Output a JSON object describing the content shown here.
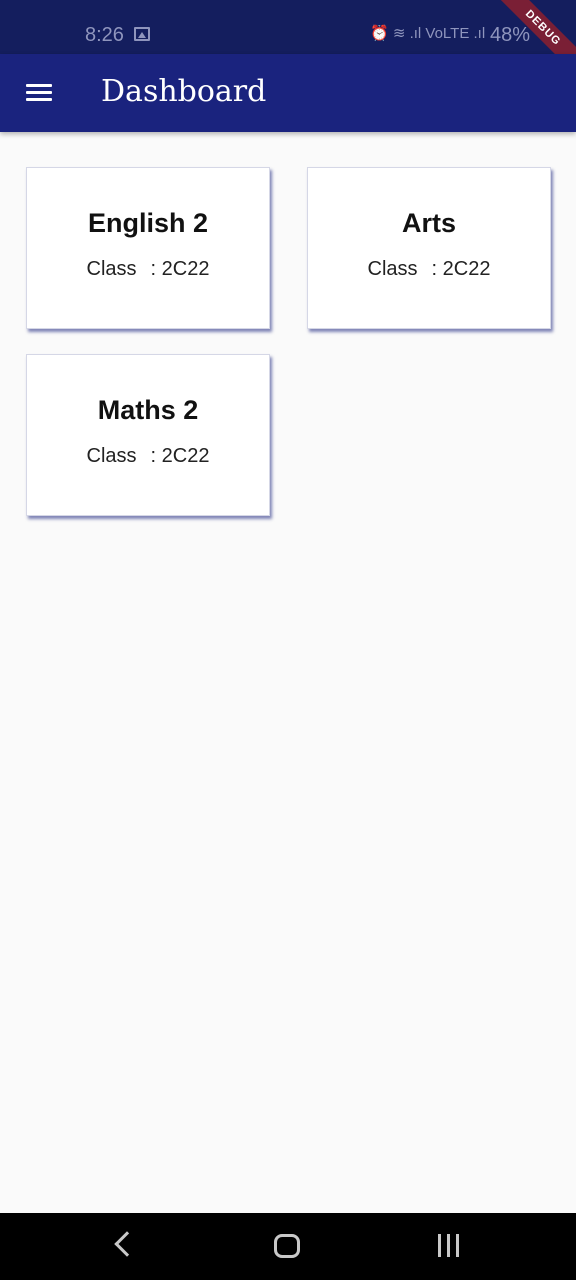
{
  "status_bar": {
    "time": "8:26",
    "network_icons": "⏰ ≋ .ıl VoLTE .ıl",
    "battery": "48%"
  },
  "debug_banner": "DEBUG",
  "app_bar": {
    "title": "Dashboard",
    "menu_icon": "menu-icon"
  },
  "cards": [
    {
      "title": "English 2",
      "class_label": "Class",
      "class_value": ": 2C22"
    },
    {
      "title": "Arts",
      "class_label": "Class",
      "class_value": ": 2C22"
    },
    {
      "title": "Maths 2",
      "class_label": "Class",
      "class_value": ": 2C22"
    }
  ],
  "nav_bar": {
    "back_icon": "back-chevron-icon",
    "home_icon": "home-icon",
    "recents_icon": "recents-icon"
  },
  "colors": {
    "primary": "#1a237e",
    "status_bar": "#141e5e",
    "background": "#fafafa",
    "debug_ribbon": "#7a1f35"
  }
}
